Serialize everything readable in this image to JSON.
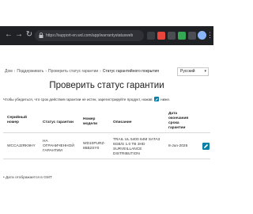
{
  "browser": {
    "url": "https://support-en.wd.com/app/warrantystatusweb",
    "back_icon": "arrow-left-icon",
    "forward_icon": "arrow-right-icon",
    "reload_icon": "reload-icon",
    "lock_icon": "lock-icon",
    "menu_icon": "more-vert-icon"
  },
  "breadcrumb": {
    "home": "Дом",
    "support": "Поддерживать",
    "check": "Проверить статус гарантии",
    "current": "Статус гарантийного покрытия"
  },
  "language": {
    "selected": "Русский"
  },
  "page": {
    "title": "Проверить статус гарантии",
    "info_before": "Чтобы убедиться, что срок действия гарантии не истек, зарегистрируйте продукт, нажав",
    "info_after": "ниже."
  },
  "table": {
    "headers": {
      "serial": [
        "Серийный",
        "номер"
      ],
      "status": "Статус гарантии",
      "model": [
        "Номер",
        "модели"
      ],
      "description": "Описание",
      "expiry": [
        "Дата",
        "окончания",
        "срока",
        "гарантии"
      ]
    },
    "rows": [
      {
        "serial": "WCCAJ2RK9HY",
        "status": [
          "НА",
          "ОГРАНИЧЕННОЙ",
          "ГАРАНТИИ"
        ],
        "model": [
          "WD10PURZ-",
          "85B2SY0"
        ],
        "description": [
          "TRAIL UL 5400 64M SATA3",
          "6GB/S 1.0 TB 3HD",
          "SURVEILLANCE",
          "DISTRIBUTION"
        ],
        "expiry": "8-Jun-2026"
      }
    ]
  },
  "footnote": "• Дата отображается в GMT",
  "colors": {
    "toolbar": "#1f2125",
    "accent": "#0a7fa8",
    "text": "#222222"
  }
}
